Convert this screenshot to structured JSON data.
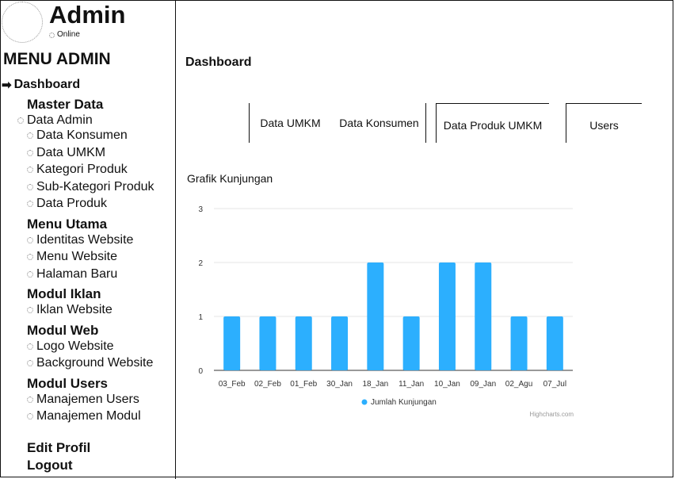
{
  "sidebar": {
    "user_name": "Admin",
    "user_status": "Online",
    "menu_title": "MENU ADMIN",
    "active_item": "Dashboard",
    "sections": [
      {
        "title": "Master Data",
        "items": [
          "Data Admin",
          "Data Konsumen",
          "Data UMKM",
          "Kategori Produk",
          "Sub-Kategori Produk",
          "Data Produk"
        ]
      },
      {
        "title": "Menu Utama",
        "items": [
          "Identitas Website",
          "Menu Website",
          "Halaman Baru"
        ]
      },
      {
        "title": "Modul Iklan",
        "items": [
          "Iklan Website"
        ]
      },
      {
        "title": "Modul Web",
        "items": [
          "Logo Website",
          "Background Website"
        ]
      },
      {
        "title": "Modul Users",
        "items": [
          "Manajemen Users",
          "Manajemen Modul"
        ]
      }
    ],
    "edit_profil": "Edit Profil",
    "logout": "Logout"
  },
  "main": {
    "title": "Dashboard",
    "tabs": [
      "Data UMKM",
      "Data Konsumen",
      "Data Produk UMKM",
      "Users"
    ]
  },
  "colors": {
    "bar": "#2caffe",
    "grid": "#e6e6e6",
    "axis": "#333333"
  },
  "chart_data": {
    "type": "bar",
    "title": "Grafik Kunjungan",
    "categories": [
      "03_Feb",
      "02_Feb",
      "01_Feb",
      "30_Jan",
      "18_Jan",
      "11_Jan",
      "10_Jan",
      "09_Jan",
      "02_Agu",
      "07_Jul"
    ],
    "series": [
      {
        "name": "Jumlah Kunjungan",
        "values": [
          1,
          1,
          1,
          1,
          2,
          1,
          2,
          2,
          1,
          1
        ]
      }
    ],
    "ylim": [
      0,
      3
    ],
    "yticks": [
      0,
      1,
      2,
      3
    ],
    "grid": true,
    "legend": "bottom-center",
    "credit": "Highcharts.com"
  }
}
